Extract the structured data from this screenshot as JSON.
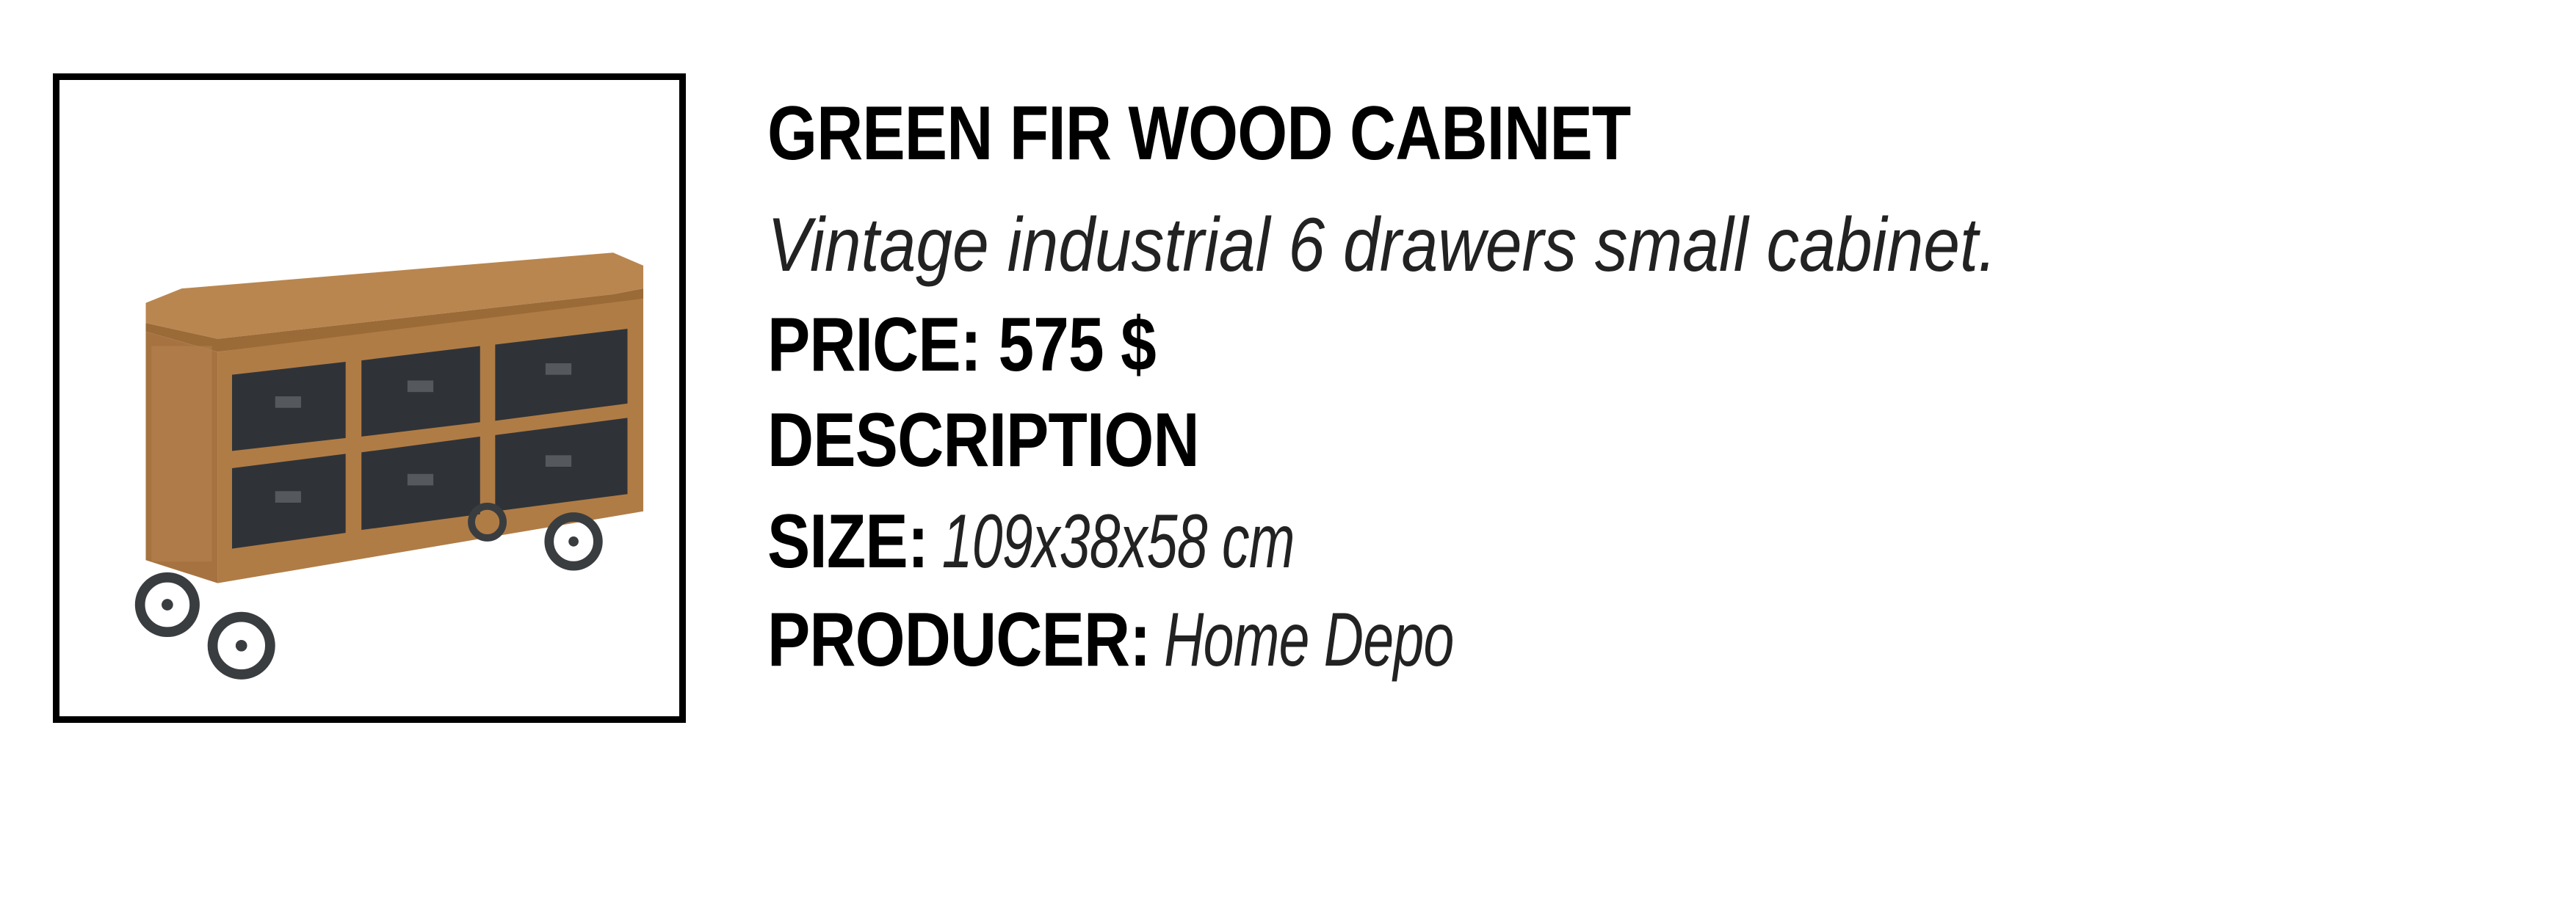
{
  "product": {
    "title": "GREEN FIR WOOD CABINET",
    "subtitle": "Vintage industrial 6 drawers small cabinet.",
    "price_label": "PRICE: 575 $",
    "description_heading": "DESCRIPTION",
    "size_label": "SIZE:",
    "size_value": "109x38x58 cm",
    "producer_label": "PRODUCER:",
    "producer_value": "Home Depo"
  },
  "image": {
    "subject": "cabinet-photo",
    "colors": {
      "wood": "#b07c45",
      "wood_dark": "#8a5c2e",
      "drawer": "#2f3338",
      "wheel": "#3a3d40",
      "frame": "#000000"
    }
  }
}
